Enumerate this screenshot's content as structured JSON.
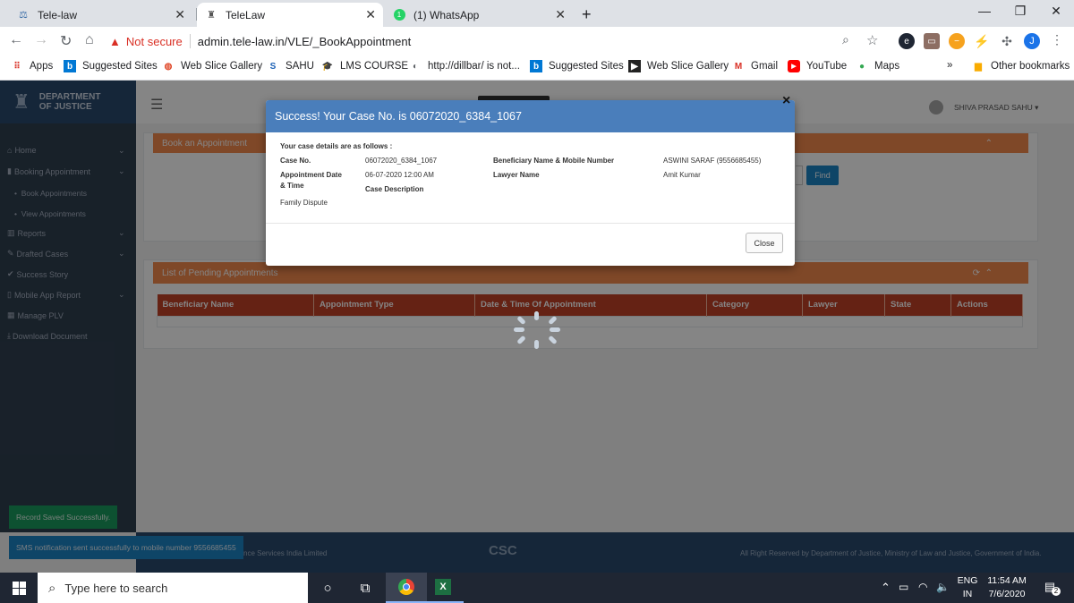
{
  "browser": {
    "tabs": [
      {
        "label": "Tele-law",
        "active": false
      },
      {
        "label": "TeleLaw",
        "active": true
      },
      {
        "label": "(1) WhatsApp",
        "active": false
      }
    ],
    "new_tab": "+",
    "security": "Not secure",
    "url": "admin.tele-law.in/VLE/_BookAppointment",
    "profile_initial": "J",
    "bookmarks": [
      "Apps",
      "Suggested Sites",
      "Web Slice Gallery",
      "SAHU",
      "LMS COURSE",
      "http://dillbar/ is not...",
      "Suggested Sites",
      "Web Slice Gallery",
      "Gmail",
      "YouTube",
      "Maps"
    ],
    "bookmarks_overflow": "»",
    "other_bookmarks": "Other bookmarks"
  },
  "app": {
    "brand_line1": "DEPARTMENT",
    "brand_line2": "OF JUSTICE",
    "user_name": "SHIVA PRASAD SAHU ▾",
    "sidebar": [
      {
        "label": "Home",
        "icon": "home-icon",
        "has_caret": true
      },
      {
        "label": "Booking Appointment",
        "icon": "bookmark-icon",
        "has_caret": true
      },
      {
        "label": "Book Appointments",
        "sub": true
      },
      {
        "label": "View Appointments",
        "sub": true
      },
      {
        "label": "Reports",
        "icon": "chart-icon",
        "has_caret": true
      },
      {
        "label": "Drafted Cases",
        "icon": "edit-icon",
        "has_caret": true
      },
      {
        "label": "Success Story",
        "icon": "check-icon",
        "has_caret": false
      },
      {
        "label": "Mobile App Report",
        "icon": "mobile-icon",
        "has_caret": true
      },
      {
        "label": "Manage PLV",
        "icon": "building-icon",
        "has_caret": false
      },
      {
        "label": "Download Document",
        "icon": "download-icon",
        "has_caret": false
      }
    ],
    "book_panel_title": "Book an Appointment",
    "find_button": "Find",
    "pending_panel_title": "List of Pending Appointments",
    "table_headers": [
      "Beneficiary Name",
      "Appointment Type",
      "Date & Time Of Appointment",
      "Category",
      "Lawyer",
      "State",
      "Actions"
    ],
    "footer_left": "nce Services India Limited",
    "footer_logo": "CSC",
    "footer_right": "All Right Reserved by Department of Justice, Ministry of Law and Justice, Government of India.",
    "toasts": [
      "Record Saved Successfully.",
      "SMS notification sent successfully to mobile number 9556685455"
    ]
  },
  "modal": {
    "title": "Success! Your Case No. is 06072020_6384_1067",
    "intro": "Your case details are as follows :",
    "case_no_label": "Case No.",
    "case_no_value": "06072020_6384_1067",
    "appt_label_1": "Appointment Date",
    "appt_label_2": "& Time",
    "appt_value": "06-07-2020 12:00 AM",
    "beneficiary_label": "Beneficiary Name & Mobile Number",
    "beneficiary_value": "ASWINI SARAF (9556685455)",
    "lawyer_label": "Lawyer Name",
    "lawyer_value": "Amit Kumar",
    "desc_label": "Case Description",
    "desc_value": "Family Dispute",
    "close_label": "Close",
    "x_label": "×"
  },
  "taskbar": {
    "search_placeholder": "Type here to search",
    "lang_1": "ENG",
    "lang_2": "IN",
    "time": "11:54 AM",
    "date": "7/6/2020",
    "notifications": "2"
  }
}
